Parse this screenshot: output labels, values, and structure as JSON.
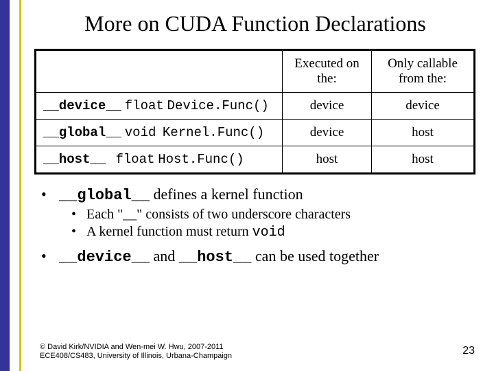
{
  "title": "More on CUDA Function Declarations",
  "table": {
    "headers": [
      "",
      "Executed on the:",
      "Only callable from the:"
    ],
    "rows": [
      {
        "qual": "__device__",
        "ret": "float",
        "func": "Device.Func()",
        "exec": "device",
        "call": "device"
      },
      {
        "qual": "__global__",
        "ret": "void",
        "func": "Kernel.Func()",
        "exec": "device",
        "call": "host"
      },
      {
        "qual": "__host__",
        "ret": "float",
        "func": "Host.Func()",
        "exec": "host",
        "call": "host"
      }
    ]
  },
  "bullets": {
    "b1a_pre": "",
    "b1a_code": "__global__",
    "b1a_post": " defines a kernel function",
    "b2a": "Each \"__\" consists of two underscore characters",
    "b2b_pre": "A kernel function must return ",
    "b2b_code": "void",
    "b1b_code1": "__device__",
    "b1b_mid": " and ",
    "b1b_code2": "__host__",
    "b1b_post": " can be used together"
  },
  "footer": {
    "line1": "© David Kirk/NVIDIA and Wen-mei W. Hwu, 2007-2011",
    "line2": "ECE408/CS483, University of Illinois, Urbana-Champaign"
  },
  "page": "23"
}
